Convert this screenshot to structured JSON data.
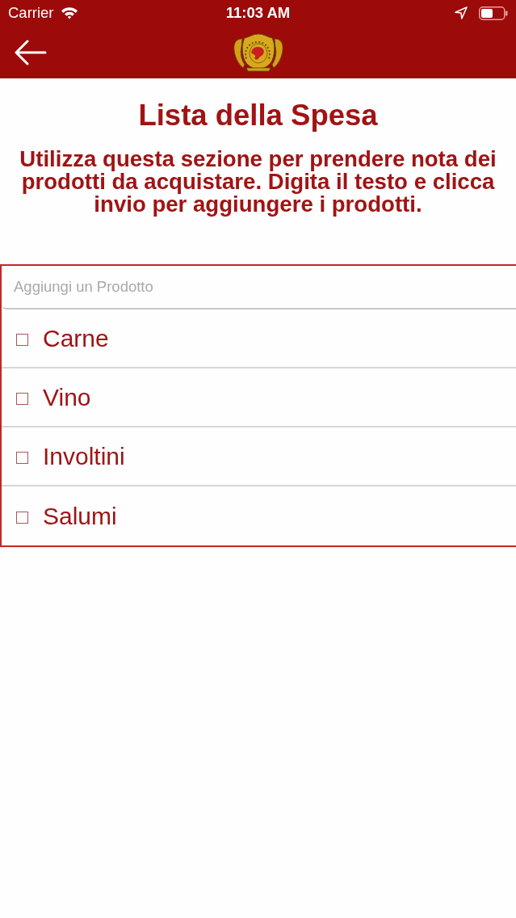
{
  "status_bar": {
    "carrier": "Carrier",
    "time": "11:03 AM"
  },
  "title": "Lista della Spesa",
  "description": "Utilizza questa sezione per prendere nota dei prodotti da acquistare. Digita il testo e clicca invio per aggiungere i prodotti.",
  "add_field": {
    "placeholder": "Aggiungi un Prodotto"
  },
  "items": [
    {
      "name": "Carne",
      "checked": false
    },
    {
      "name": "Vino",
      "checked": false
    },
    {
      "name": "Involtini",
      "checked": false
    },
    {
      "name": "Salumi",
      "checked": false
    }
  ]
}
